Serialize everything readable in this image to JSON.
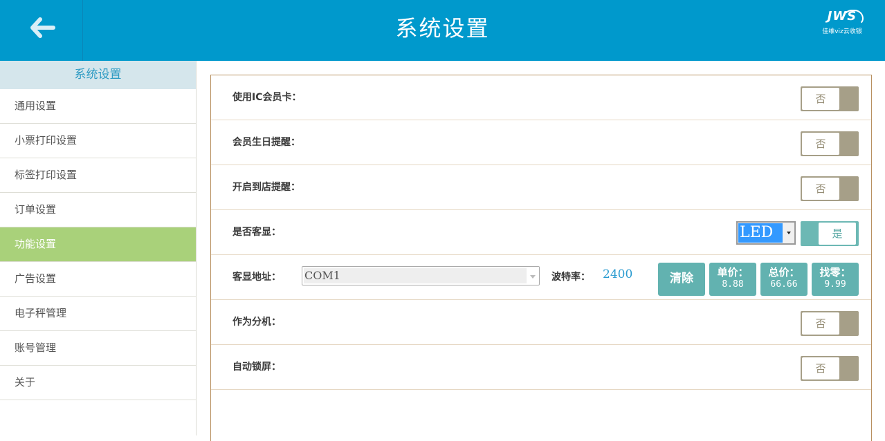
{
  "header": {
    "title": "系统设置",
    "back_icon": "arrow-left-icon",
    "logo": {
      "brand": "JWS",
      "subtitle": "佳维viz云收银"
    }
  },
  "sidebar": {
    "title": "系统设置",
    "items": [
      {
        "label": "通用设置",
        "active": false
      },
      {
        "label": "小票打印设置",
        "active": false
      },
      {
        "label": "标签打印设置",
        "active": false
      },
      {
        "label": "订单设置",
        "active": false
      },
      {
        "label": "功能设置",
        "active": true
      },
      {
        "label": "广告设置",
        "active": false
      },
      {
        "label": "电子秤管理",
        "active": false
      },
      {
        "label": "账号管理",
        "active": false
      },
      {
        "label": "关于",
        "active": false
      }
    ]
  },
  "settings": {
    "ic_card": {
      "label": "使用IC会员卡：",
      "value": "否"
    },
    "birthday_reminder": {
      "label": "会员生日提醒：",
      "value": "否"
    },
    "arrival_reminder": {
      "label": "开启到店提醒：",
      "value": "否"
    },
    "customer_display": {
      "label": "是否客显：",
      "type_value": "LED",
      "value": "是"
    },
    "display_address": {
      "label": "客显地址：",
      "port_value": "COM1",
      "baud_label": "波特率：",
      "baud_value": "2400",
      "buttons": {
        "clear": "清除",
        "unit_price": {
          "label": "单价：",
          "value": "8.88"
        },
        "total_price": {
          "label": "总价：",
          "value": "66.66"
        },
        "change": {
          "label": "找零：",
          "value": "9.99"
        }
      }
    },
    "sub_terminal": {
      "label": "作为分机：",
      "value": "否"
    },
    "auto_lock": {
      "label": "自动锁屏：",
      "value": "否"
    }
  },
  "colors": {
    "header_bg": "#0099cc",
    "active_item": "#a9d17a",
    "toggle_off": "#a69f88",
    "toggle_on": "#6cb8b4",
    "button_teal": "#62b2b0",
    "panel_border": "#b89060"
  }
}
